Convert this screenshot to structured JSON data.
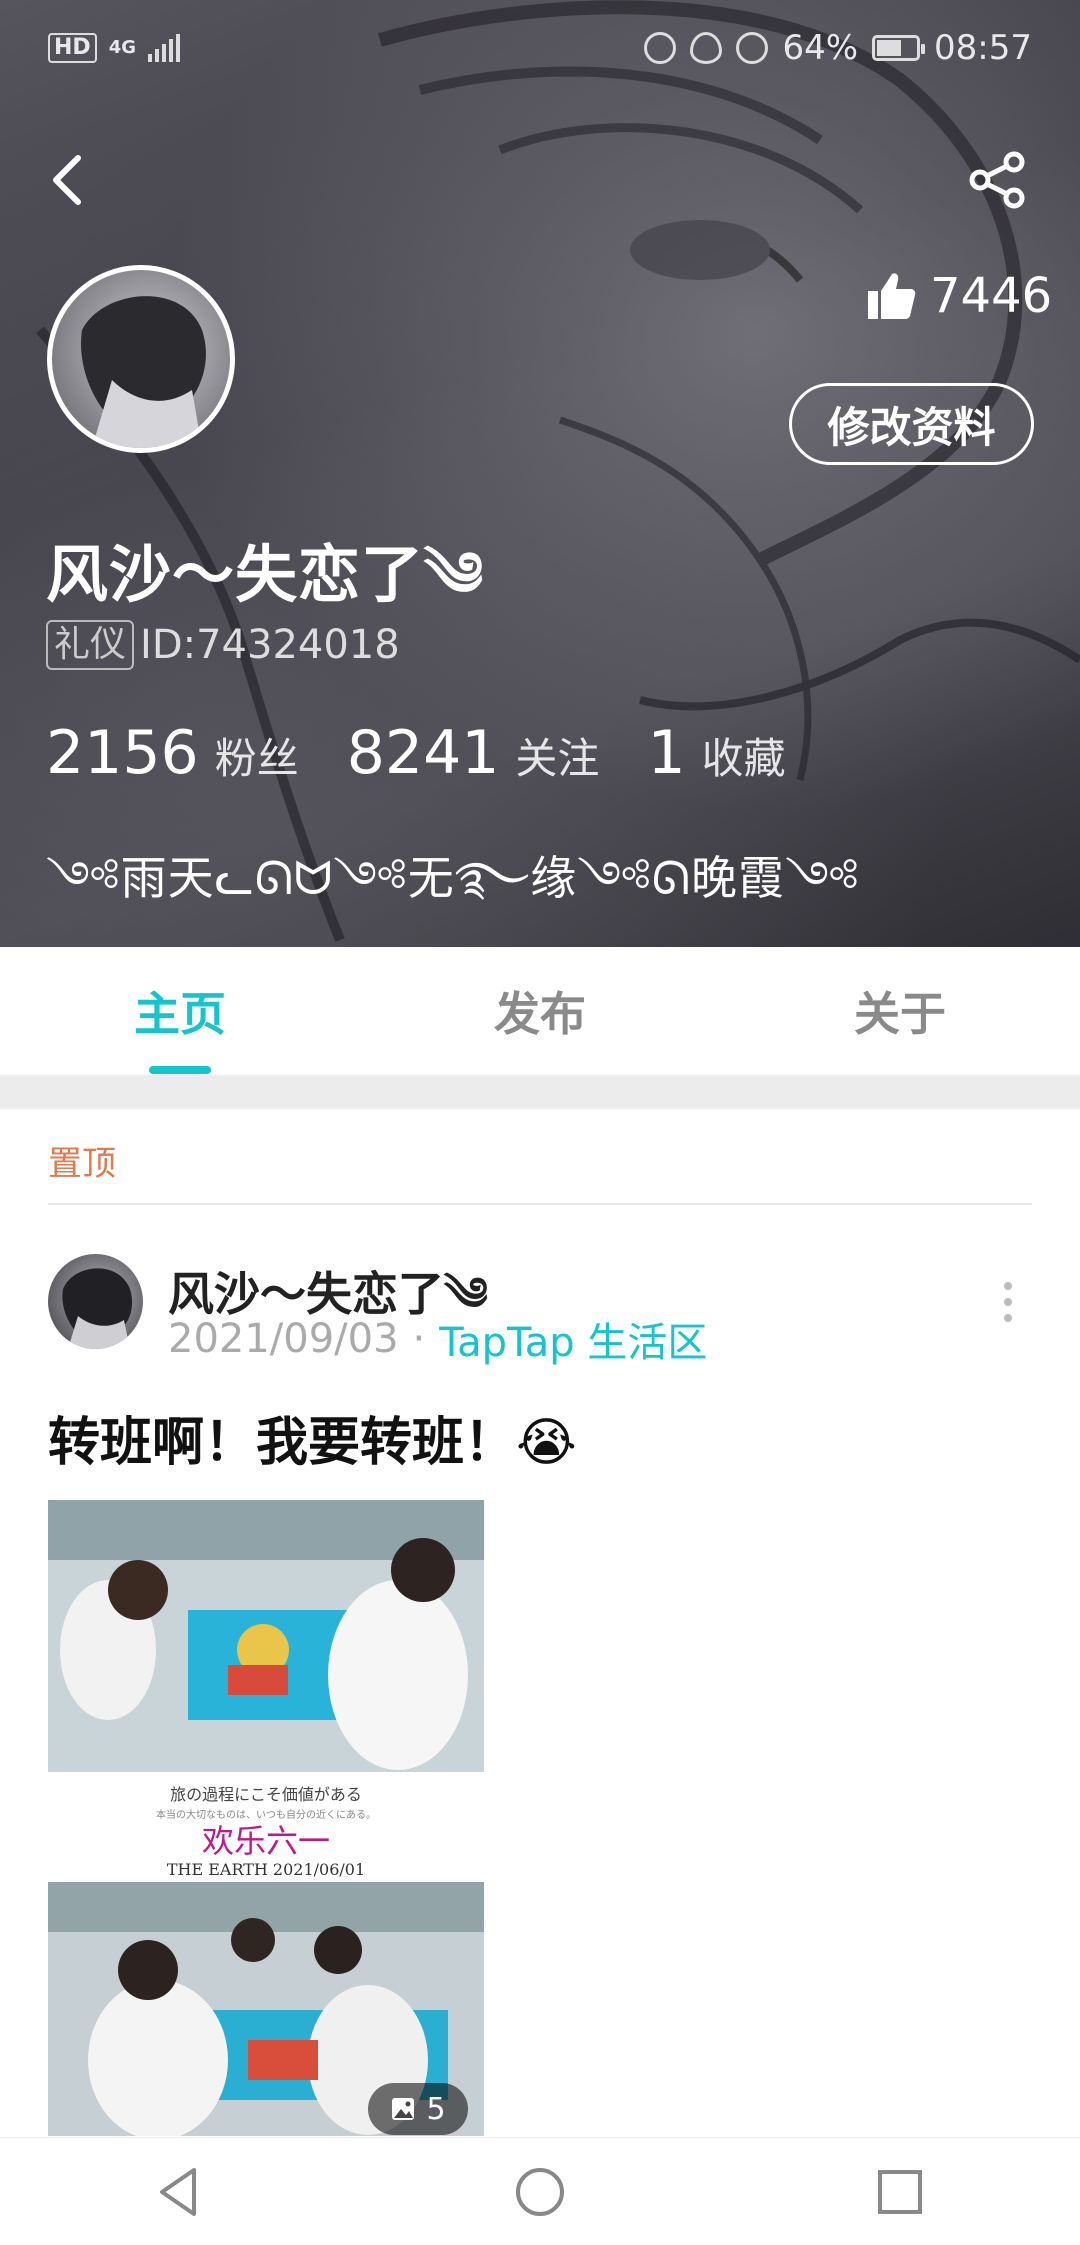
{
  "status_bar": {
    "hd": "HD",
    "network": "4G",
    "battery": "64%",
    "battery_level": 0.64,
    "time": "08:57"
  },
  "profile": {
    "likes": "7446",
    "edit_label": "修改资料",
    "username": "风沙～失恋了༄",
    "badge": "礼仪",
    "id_text": "ID:74324018",
    "stats": [
      {
        "num": "2156",
        "label": "粉丝"
      },
      {
        "num": "8241",
        "label": "关注"
      },
      {
        "num": "1",
        "label": "收藏"
      }
    ],
    "bio": "༺雨天ᓚᘏᗢ༺无࿐缘༺ᘏ晚霞༺"
  },
  "tabs": [
    "主页",
    "发布",
    "关于"
  ],
  "feed": {
    "pinned_label": "置顶",
    "post": {
      "author": "风沙～失恋了༄",
      "date": "2021/09/03",
      "separator": "·",
      "forum": "TapTap 生活区",
      "text": "转班啊！我要转班！😭",
      "image_overlay": {
        "caption_jp": "旅の過程にこそ価値がある",
        "caption_small": "本当の大切なものは、いつも自分の近くにある。",
        "title": "欢乐六一",
        "subtitle": "THE EARTH  2021/06/01"
      },
      "image_count": "5"
    }
  },
  "colors": {
    "accent": "#15c5ce",
    "pinned": "#e07a4f"
  }
}
